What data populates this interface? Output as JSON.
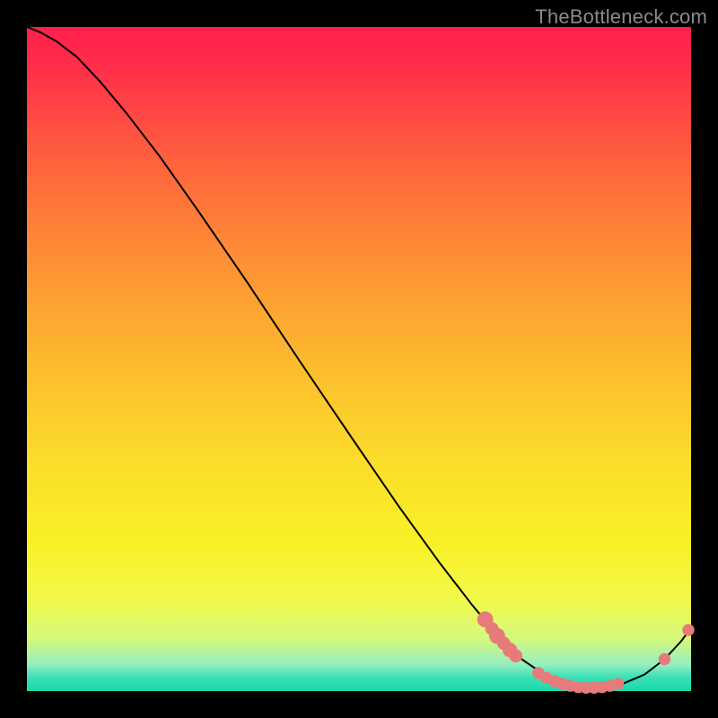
{
  "watermark": "TheBottleneck.com",
  "chart_data": {
    "type": "line",
    "title": "",
    "xlabel": "",
    "ylabel": "",
    "xlim": [
      0,
      1
    ],
    "ylim": [
      0,
      1
    ],
    "curve": [
      {
        "x": 0.0,
        "y": 1.0
      },
      {
        "x": 0.02,
        "y": 0.992
      },
      {
        "x": 0.045,
        "y": 0.978
      },
      {
        "x": 0.075,
        "y": 0.955
      },
      {
        "x": 0.11,
        "y": 0.918
      },
      {
        "x": 0.15,
        "y": 0.87
      },
      {
        "x": 0.2,
        "y": 0.805
      },
      {
        "x": 0.26,
        "y": 0.72
      },
      {
        "x": 0.33,
        "y": 0.618
      },
      {
        "x": 0.41,
        "y": 0.498
      },
      {
        "x": 0.49,
        "y": 0.38
      },
      {
        "x": 0.56,
        "y": 0.278
      },
      {
        "x": 0.62,
        "y": 0.195
      },
      {
        "x": 0.67,
        "y": 0.13
      },
      {
        "x": 0.71,
        "y": 0.082
      },
      {
        "x": 0.745,
        "y": 0.048
      },
      {
        "x": 0.78,
        "y": 0.024
      },
      {
        "x": 0.815,
        "y": 0.01
      },
      {
        "x": 0.855,
        "y": 0.005
      },
      {
        "x": 0.895,
        "y": 0.01
      },
      {
        "x": 0.93,
        "y": 0.025
      },
      {
        "x": 0.96,
        "y": 0.048
      },
      {
        "x": 0.985,
        "y": 0.075
      },
      {
        "x": 1.0,
        "y": 0.095
      }
    ],
    "points_cluster_upper": [
      {
        "x": 0.69,
        "y": 0.108,
        "r": 0.012
      },
      {
        "x": 0.7,
        "y": 0.094,
        "r": 0.01
      },
      {
        "x": 0.708,
        "y": 0.083,
        "r": 0.012
      },
      {
        "x": 0.718,
        "y": 0.072,
        "r": 0.01
      },
      {
        "x": 0.727,
        "y": 0.062,
        "r": 0.011
      },
      {
        "x": 0.736,
        "y": 0.053,
        "r": 0.01
      }
    ],
    "points_cluster_lower": [
      {
        "x": 0.77,
        "y": 0.027,
        "r": 0.009
      },
      {
        "x": 0.782,
        "y": 0.02,
        "r": 0.009
      },
      {
        "x": 0.794,
        "y": 0.015,
        "r": 0.009
      },
      {
        "x": 0.806,
        "y": 0.011,
        "r": 0.009
      },
      {
        "x": 0.818,
        "y": 0.008,
        "r": 0.009
      },
      {
        "x": 0.83,
        "y": 0.006,
        "r": 0.009
      },
      {
        "x": 0.842,
        "y": 0.005,
        "r": 0.009
      },
      {
        "x": 0.854,
        "y": 0.005,
        "r": 0.009
      },
      {
        "x": 0.866,
        "y": 0.006,
        "r": 0.009
      },
      {
        "x": 0.878,
        "y": 0.008,
        "r": 0.009
      },
      {
        "x": 0.89,
        "y": 0.011,
        "r": 0.009
      }
    ],
    "points_tail": [
      {
        "x": 0.96,
        "y": 0.048,
        "r": 0.009
      },
      {
        "x": 0.996,
        "y": 0.092,
        "r": 0.009
      }
    ],
    "point_color": "#e77a7a",
    "curve_color": "#000000",
    "curve_width": 2
  }
}
